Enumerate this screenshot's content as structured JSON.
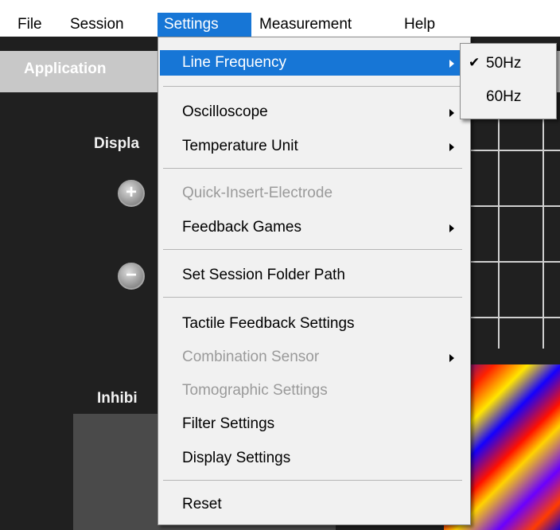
{
  "menubar": {
    "items": [
      "File",
      "Session",
      "Settings",
      "Measurement",
      "Help"
    ]
  },
  "app_panel": {
    "title": "Application"
  },
  "side_labels": {
    "display": "Displa",
    "inhibit": "Inhibi"
  },
  "buttons": {
    "plus": "+",
    "minus": "−"
  },
  "settings_menu": {
    "line_frequency": "Line Frequency",
    "oscilloscope": "Oscilloscope",
    "temperature_unit": "Temperature Unit",
    "quick_insert_electrode": "Quick-Insert-Electrode",
    "feedback_games": "Feedback Games",
    "set_session_folder_path": "Set Session Folder Path",
    "tactile_feedback_settings": "Tactile Feedback Settings",
    "combination_sensor": "Combination Sensor",
    "tomographic_settings": "Tomographic Settings",
    "filter_settings": "Filter Settings",
    "display_settings": "Display Settings",
    "reset": "Reset"
  },
  "line_frequency_submenu": {
    "options": [
      "50Hz",
      "60Hz"
    ],
    "selected": "50Hz",
    "check_symbol": "✔"
  },
  "colors": {
    "menu_highlight": "#1776d6",
    "menu_bg": "#f1f1f1",
    "disabled_text": "#9a9a9a",
    "dark_bg": "#202020"
  }
}
